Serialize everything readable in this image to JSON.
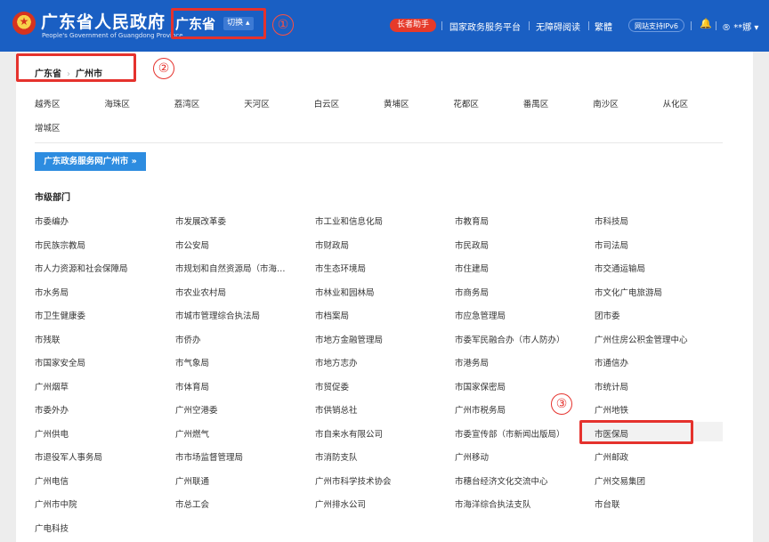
{
  "header": {
    "title": "广东省人民政府",
    "subtitle": "People's Government of Guangdong Province",
    "region": "广东省",
    "switch_label": "切换",
    "elder_helper": "长者助手",
    "links": [
      "国家政务服务平台",
      "无障碍阅读",
      "繁體"
    ],
    "ipv6": "网站支持IPv6",
    "bell_icon": "bell-icon",
    "user_label": "**娜"
  },
  "annotations": [
    "①",
    "②",
    "③"
  ],
  "breadcrumb": [
    "广东省",
    "广州市"
  ],
  "districts": [
    "越秀区",
    "海珠区",
    "荔湾区",
    "天河区",
    "白云区",
    "黄埔区",
    "花都区",
    "番禺区",
    "南沙区",
    "从化区",
    "增城区"
  ],
  "portal_button": "广东政务服务网广州市 »",
  "section_title": "市级部门",
  "highlight_color": "#e5322d",
  "departments": [
    [
      "市委编办",
      "市发展改革委",
      "市工业和信息化局",
      "市教育局",
      "市科技局"
    ],
    [
      "市民族宗教局",
      "市公安局",
      "市财政局",
      "市民政局",
      "市司法局"
    ],
    [
      "市人力资源和社会保障局",
      "市规划和自然资源局（市海洋局）",
      "市生态环境局",
      "市住建局",
      "市交通运输局"
    ],
    [
      "市水务局",
      "市农业农村局",
      "市林业和园林局",
      "市商务局",
      "市文化广电旅游局"
    ],
    [
      "市卫生健康委",
      "市城市管理综合执法局",
      "市档案局",
      "市应急管理局",
      "团市委"
    ],
    [
      "市残联",
      "市侨办",
      "市地方金融管理局",
      "市委军民融合办（市人防办）",
      "广州住房公积金管理中心"
    ],
    [
      "市国家安全局",
      "市气象局",
      "市地方志办",
      "市港务局",
      "市通信办"
    ],
    [
      "广州烟草",
      "市体育局",
      "市贸促委",
      "市国家保密局",
      "市统计局"
    ],
    [
      "市委外办",
      "广州空港委",
      "市供销总社",
      "广州市税务局",
      "广州地铁"
    ],
    [
      "广州供电",
      "广州燃气",
      "市自来水有限公司",
      "市委宣传部（市新闻出版局）",
      "市医保局"
    ],
    [
      "市退役军人事务局",
      "市市场监督管理局",
      "市消防支队",
      "广州移动",
      "广州邮政"
    ],
    [
      "广州电信",
      "广州联通",
      "广州市科学技术协会",
      "市穗台经济文化交流中心",
      "广州交易集团"
    ],
    [
      "广州市中院",
      "市总工会",
      "广州排水公司",
      "市海洋综合执法支队",
      "市台联"
    ],
    [
      "广电科技"
    ]
  ]
}
